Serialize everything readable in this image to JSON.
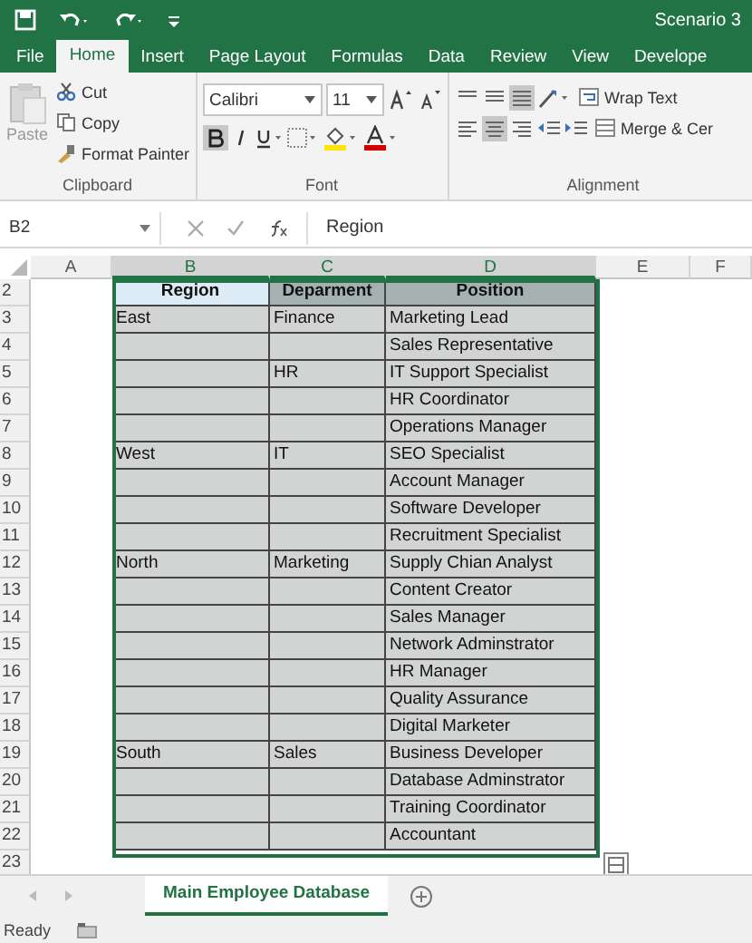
{
  "window": {
    "title": "Scenario 3"
  },
  "ribbon_tabs": [
    {
      "label": "File",
      "selected": false
    },
    {
      "label": "Home",
      "selected": true
    },
    {
      "label": "Insert",
      "selected": false
    },
    {
      "label": "Page Layout",
      "selected": false
    },
    {
      "label": "Formulas",
      "selected": false
    },
    {
      "label": "Data",
      "selected": false
    },
    {
      "label": "Review",
      "selected": false
    },
    {
      "label": "View",
      "selected": false
    },
    {
      "label": "Develope",
      "selected": false
    }
  ],
  "clipboard": {
    "paste": "Paste",
    "cut": "Cut",
    "copy": "Copy",
    "format_painter": "Format Painter",
    "label": "Clipboard"
  },
  "font": {
    "name": "Calibri",
    "size": "11",
    "label": "Font"
  },
  "alignment": {
    "wrap_text": "Wrap Text",
    "merge": "Merge & Cer",
    "label": "Alignment"
  },
  "formula_bar": {
    "name_box": "B2",
    "formula": "Region"
  },
  "columns": [
    {
      "label": "A",
      "selected": false
    },
    {
      "label": "B",
      "selected": true
    },
    {
      "label": "C",
      "selected": true
    },
    {
      "label": "D",
      "selected": true
    },
    {
      "label": "E",
      "selected": false
    },
    {
      "label": "F",
      "selected": false
    }
  ],
  "table": {
    "header": [
      {
        "text": "Region",
        "selected": true
      },
      {
        "text": "Deparment",
        "selected": false
      },
      {
        "text": "Position",
        "selected": false
      }
    ],
    "rows": [
      [
        "East",
        "Finance",
        "Marketing Lead"
      ],
      [
        "",
        "",
        "Sales Representative"
      ],
      [
        "",
        "HR",
        "IT Support Specialist"
      ],
      [
        "",
        "",
        "HR Coordinator"
      ],
      [
        "",
        "",
        "Operations Manager"
      ],
      [
        "West",
        "IT",
        "SEO Specialist"
      ],
      [
        "",
        "",
        "Account Manager"
      ],
      [
        "",
        "",
        "Software Developer"
      ],
      [
        "",
        "",
        "Recruitment Specialist"
      ],
      [
        "North",
        "Marketing",
        "Supply Chian Analyst"
      ],
      [
        "",
        "",
        "Content Creator"
      ],
      [
        "",
        "",
        "Sales Manager"
      ],
      [
        "",
        "",
        "Network Adminstrator"
      ],
      [
        "",
        "",
        "HR Manager"
      ],
      [
        "",
        "",
        "Quality Assurance"
      ],
      [
        "",
        "",
        "Digital Marketer"
      ],
      [
        "South",
        "Sales",
        "Business Developer"
      ],
      [
        "",
        "",
        "Database Adminstrator"
      ],
      [
        "",
        "",
        "Training Coordinator"
      ],
      [
        "",
        "",
        "Accountant"
      ]
    ]
  },
  "row_numbers": [
    "2",
    "3",
    "4",
    "5",
    "6",
    "7",
    "8",
    "9",
    "10",
    "11",
    "12",
    "13",
    "14",
    "15",
    "16",
    "17",
    "18",
    "19",
    "20",
    "21",
    "22",
    "23"
  ],
  "sheet_tabs": [
    {
      "label": "Main Employee Database",
      "selected": true
    }
  ],
  "status_bar": {
    "text": "Ready"
  }
}
